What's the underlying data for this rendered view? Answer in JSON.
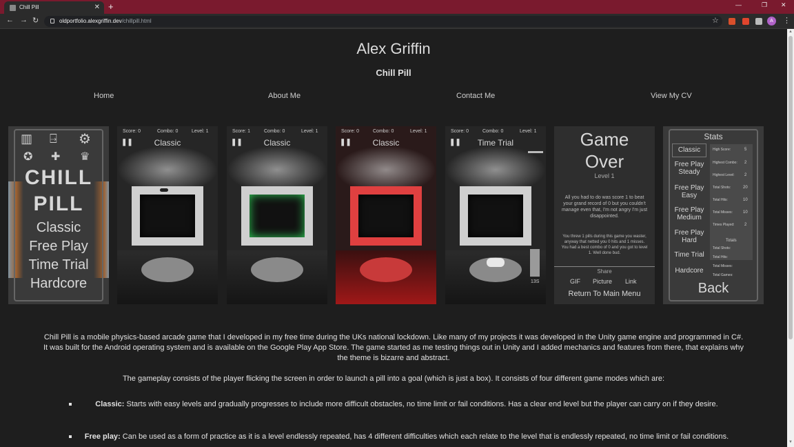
{
  "browser": {
    "tab_title": "Chill Pill",
    "tab_close": "✕",
    "new_tab": "+",
    "url_domain": "oldportfolio.alexgriffin.dev",
    "url_path": "/chillpill.html",
    "avatar_letter": "A"
  },
  "site": {
    "title": "Alex Griffin",
    "subtitle": "Chill Pill",
    "nav": [
      "Home",
      "About Me",
      "Contact Me",
      "View My CV"
    ]
  },
  "screens": {
    "menu": {
      "logo_line1": "CHILL",
      "logo_line2": "PILL",
      "options": [
        "Classic",
        "Free Play",
        "Time Trial",
        "Hardcore"
      ]
    },
    "game1": {
      "score": "Score: 0",
      "combo": "Combo: 0",
      "level": "Level: 1",
      "mode": "Classic"
    },
    "game2": {
      "score": "Score: 1",
      "combo": "Combo: 0",
      "level": "Level: 1",
      "mode": "Classic"
    },
    "game3": {
      "score": "Score: 0",
      "combo": "Combo: 0",
      "level": "Level: 1",
      "mode": "Classic"
    },
    "game4": {
      "score": "Score: 0",
      "combo": "Combo: 0",
      "level": "Level: 1",
      "mode": "Time Trial",
      "timer": "13S"
    },
    "gameover": {
      "title_line1": "Game",
      "title_line2": "Over",
      "level": "Level 1",
      "message1": "All you had to do was score 1 to beat your grand record of 0 but you couldn't manage even that, I'm not angry I'm just disappointed.",
      "message2": "You threw 1 pills during this game you waster, anyway that netted you 0 hits and 1 misses. You had a best combo of 0 and you got to level 1. Well done bud.",
      "share": "Share",
      "share_options": [
        "GIF",
        "Picture",
        "Link"
      ],
      "return": "Return To Main Menu"
    },
    "stats": {
      "title": "Stats",
      "modes": [
        "Classic",
        "Free Play Steady",
        "Free Play Easy",
        "Free Play Medium",
        "Free Play Hard",
        "Time Trial",
        "Hardcore"
      ],
      "rows": [
        {
          "label": "High Score:",
          "value": "5"
        },
        {
          "label": "Highest Combo:",
          "value": "2"
        },
        {
          "label": "Highest Level:",
          "value": "2"
        },
        {
          "label": "Total Shots:",
          "value": "20"
        },
        {
          "label": "Total Hits:",
          "value": "10"
        },
        {
          "label": "Total Misses:",
          "value": "10"
        },
        {
          "label": "Times Played:",
          "value": "2"
        }
      ],
      "totals_title": "Totals",
      "totals": [
        "Total Shots:",
        "Total Hits:",
        "Total Misses:",
        "Total Games:"
      ],
      "back": "Back"
    }
  },
  "article": {
    "p1": "Chill Pill is a mobile physics-based arcade game that I developed in my free time during the UKs national lockdown. Like many of my projects it was developed in the Unity game engine and programmed in C#. It was built for the Android operating system and is available on the Google Play App Store. The game started as me testing things out in Unity and I added mechanics and features from there, that explains why the theme is bizarre and abstract.",
    "p2": "The gameplay consists of the player flicking the screen in order to launch a pill into a goal (which is just a box). It consists of four different game modes which are:",
    "b1_label": "Classic:",
    "b1_text": " Starts with easy levels and gradually progresses to include more difficult obstacles, no time limit or fail conditions. Has a clear end level but the player can carry on if they desire.",
    "b2_label": "Free play:",
    "b2_text": " Can be used as a form of practice as it is a level endlessly repeated, has 4 different difficulties which each relate to the level that is endlessly repeated, no time limit or fail conditions."
  }
}
